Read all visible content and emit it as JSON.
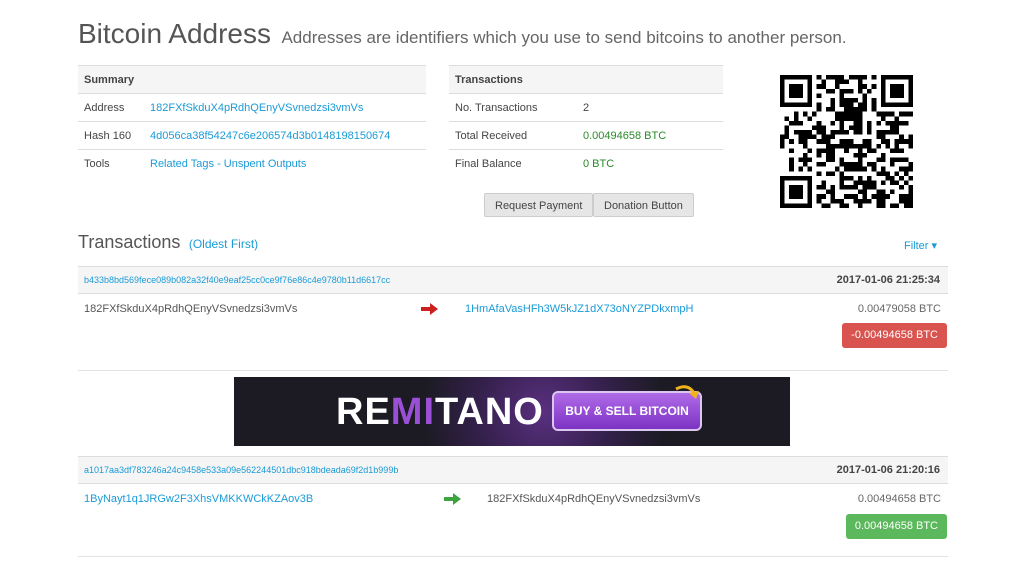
{
  "header": {
    "title": "Bitcoin Address",
    "subtitle": "Addresses are identifiers which you use to send bitcoins to another person."
  },
  "summary": {
    "heading": "Summary",
    "rows": [
      {
        "label": "Address",
        "value": "182FXfSkduX4pRdhQEnyVSvnedzsi3vmVs"
      },
      {
        "label": "Hash 160",
        "value": "4d056ca38f54247c6e206574d3b0148198150674"
      },
      {
        "label": "Tools",
        "link1": "Related Tags",
        "sep": " - ",
        "link2": "Unspent Outputs"
      }
    ]
  },
  "transactions_box": {
    "heading": "Transactions",
    "rows": [
      {
        "label": "No. Transactions",
        "value": "2"
      },
      {
        "label": "Total Received",
        "value": "0.00494658 BTC"
      },
      {
        "label": "Final Balance",
        "value": "0 BTC"
      }
    ]
  },
  "buttons": {
    "request_payment": "Request Payment",
    "donation_button": "Donation Button"
  },
  "tx_section": {
    "title": "Transactions",
    "order": "(Oldest First)",
    "filter": "Filter ▾"
  },
  "txs": [
    {
      "hash": "b433b8bd569fece089b082a32f40e9eaf25cc0ce9f76e86c4e9780b11d6617cc",
      "time": "2017-01-06 21:25:34",
      "from": "182FXfSkduX4pRdhQEnyVSvnedzsi3vmVs",
      "to": "1HmAfaVasHFh3W5kJZ1dX73oNYZPDkxmpH",
      "amount": "0.00479058 BTC",
      "net": "-0.00494658 BTC"
    },
    {
      "hash": "a1017aa3df783246a24c9458e533a09e562244501dbc918bdeada69f2d1b999b",
      "time": "2017-01-06 21:20:16",
      "from": "1ByNayt1q1JRGw2F3XhsVMKKWCkKZAov3B",
      "to": "182FXfSkduX4pRdhQEnyVSvnedzsi3vmVs",
      "amount": "0.00494658 BTC",
      "net": "0.00494658 BTC"
    }
  ],
  "ad": {
    "logo_r": "RE",
    "logo_m": "MI",
    "logo_rest": "TANO",
    "cta": "BUY & SELL BITCOIN"
  },
  "colors": {
    "link": "#1a9bd7",
    "negative": "#d9534f",
    "positive": "#5cb85c",
    "arrow_out": "#cc1f1f",
    "arrow_in": "#3fa33f"
  }
}
